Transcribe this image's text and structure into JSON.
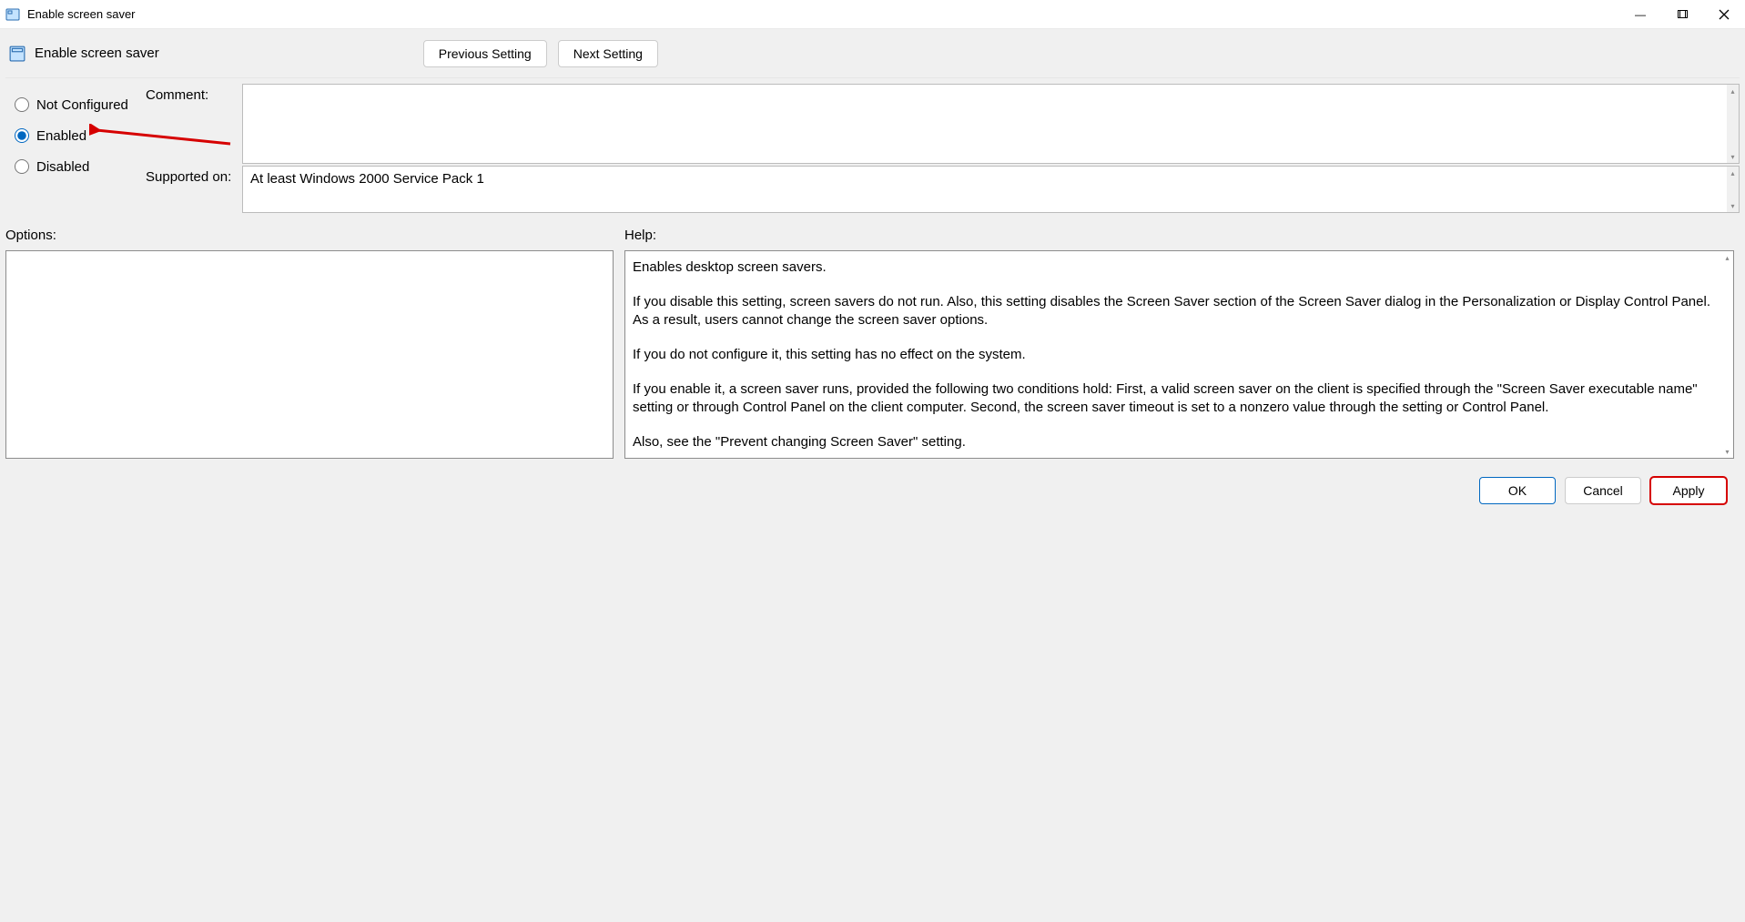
{
  "window": {
    "title": "Enable screen saver"
  },
  "policy": {
    "name": "Enable screen saver"
  },
  "nav": {
    "previous": "Previous Setting",
    "next": "Next Setting"
  },
  "radios": {
    "not_configured": "Not Configured",
    "enabled": "Enabled",
    "disabled": "Disabled",
    "selected": "enabled"
  },
  "labels": {
    "comment": "Comment:",
    "supported_on": "Supported on:",
    "options": "Options:",
    "help": "Help:"
  },
  "fields": {
    "comment": "",
    "supported_on": "At least Windows 2000 Service Pack 1"
  },
  "help_text": "Enables desktop screen savers.\n\nIf you disable this setting, screen savers do not run. Also, this setting disables the Screen Saver section of the Screen Saver dialog in the Personalization or Display Control Panel. As a result, users cannot change the screen saver options.\n\nIf you do not configure it, this setting has no effect on the system.\n\nIf you enable it, a screen saver runs, provided the following two conditions hold: First, a valid screen saver on the client is specified through the \"Screen Saver executable name\" setting or through Control Panel on the client computer. Second, the screen saver timeout is set to a nonzero value through the setting or Control Panel.\n\nAlso, see the \"Prevent changing Screen Saver\" setting.",
  "footer": {
    "ok": "OK",
    "cancel": "Cancel",
    "apply": "Apply"
  },
  "annotations": {
    "arrow_target": "enabled-radio",
    "highlight_button": "apply-button"
  }
}
